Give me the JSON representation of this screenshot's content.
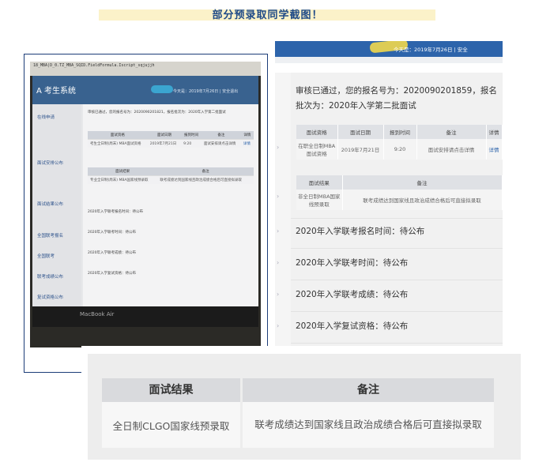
{
  "page_title": "部分预录取同学截图！",
  "photo": {
    "browser_tab": "18_MBA|D_0.TZ_MBA_SQID.FieldFormula.Iscript_sqjujjh",
    "system_title": "A 考生系统",
    "user_info": "今天是：2019年7月26日 | 安全退出",
    "sidebar": [
      "在线申请",
      "面试安排公布",
      "面试结果公布",
      "全国联考报名",
      "全国联考",
      "联考成绩公布",
      "复试资格公布"
    ],
    "notice": "审核已通过，您的报名号为：2020090201821，报名批次为：2020年入学第二批面试",
    "interview_headers": [
      "面试资格",
      "面试日期",
      "报到时间",
      "备注",
      "详情"
    ],
    "interview_row": [
      "考生全日制(周末) MBA面试资格",
      "2019年7月21日",
      "9:20",
      "面试安排请点击详情",
      "详情"
    ],
    "result_headers": [
      "面试结果",
      "备注"
    ],
    "result_row": [
      "专业全日制(周末) MBA国家线预录取",
      "联考成绩达到国家线且政治成绩合格后可直接拟录取"
    ],
    "lines": [
      "2020年入学联考报名时间：待公布",
      "2020年入学联考时间：待公布",
      "2020年入学联考成绩：待公布",
      "2020年入学复试资格：待公布"
    ],
    "monitor_brand": "MacBook Air"
  },
  "right": {
    "header_text": "今天是：2019年7月26日 | 安全",
    "notice": "审核已通过，您的报名号为：2020090201859，报名批次为：2020年入学第二批面试",
    "interview_headers": [
      "面试资格",
      "面试日期",
      "报到时间",
      "备注",
      "详情"
    ],
    "interview_row": [
      "在职全日制MBA面试资格",
      "2019年7月21日",
      "9:20",
      "面试安排请点击详情",
      "详情"
    ],
    "result_headers": [
      "面试结果",
      "备注"
    ],
    "result_row": [
      "非全日制MBA国家线预录取",
      "联考成绩达到国家线且政治成绩合格后可直接拟录取"
    ],
    "lines": [
      "2020年入学联考报名时间：待公布",
      "2020年入学联考时间：待公布",
      "2020年入学联考成绩：待公布",
      "2020年入学复试资格：待公布"
    ]
  },
  "zoom": {
    "headers": [
      "面试结果",
      "备注"
    ],
    "row": [
      "全日制CLGO国家线预录取",
      "联考成绩达到国家线且政治成绩合格后可直接拟录取"
    ]
  },
  "colors": {
    "title": "#1f4a87",
    "title_bg": "#fbf2c9",
    "header_blue": "#2d64ab",
    "frame": "#1c3c78"
  }
}
